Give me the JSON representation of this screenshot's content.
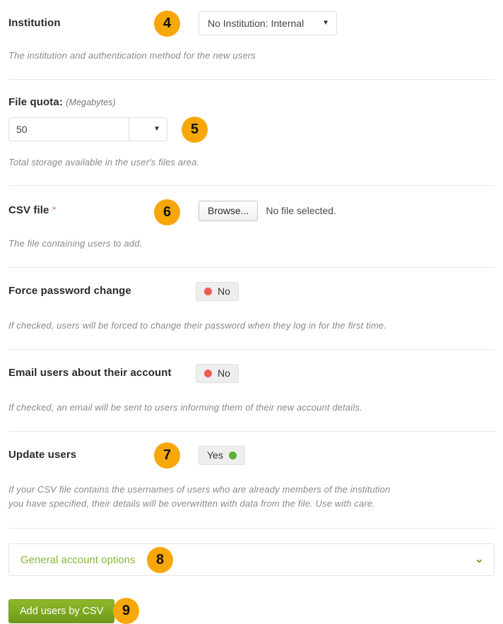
{
  "form": {
    "rows": [
      {
        "key": "institution",
        "label": "Institution",
        "badge": "4",
        "control_type": "select",
        "value": "No Institution: Internal",
        "caret_icon": "▼",
        "help": "The institution and authentication method for the new users"
      },
      {
        "key": "file_quota",
        "label": "File quota:",
        "units": "(Megabytes)",
        "badge": "5",
        "control_type": "number-stepper",
        "value": "50",
        "caret_icon": "▼",
        "help": "Total storage available in the user's files area."
      },
      {
        "key": "csv_file",
        "label": "CSV file",
        "required_marker": "*",
        "badge": "6",
        "control_type": "file",
        "browse_label": "Browse...",
        "file_status": "No file selected.",
        "help": "The file containing users to add."
      },
      {
        "key": "force_password_change",
        "label": "Force password change",
        "control_type": "switch",
        "value": "No",
        "state": "off",
        "help": "If checked, users will be forced to change their password when they log in for the first time."
      },
      {
        "key": "email_users",
        "label": "Email users about their account",
        "control_type": "switch",
        "value": "No",
        "state": "off",
        "help": "If checked, an email will be sent to users informing them of their new account details."
      },
      {
        "key": "update_users",
        "label": "Update users",
        "badge": "7",
        "control_type": "switch",
        "value": "Yes",
        "state": "on",
        "help": "If your CSV file contains the usernames of users who are already members of the institution you have specified, their details will be overwritten with data from the file. Use with care."
      }
    ]
  },
  "collapsible": {
    "title": "General account options",
    "badge": "8",
    "chevron_icon": "⌄"
  },
  "submit": {
    "label": "Add users by CSV",
    "badge": "9"
  },
  "colors": {
    "badge_bg": "#f7a708",
    "accent_green": "#8bb63c",
    "button_green": "#6f9a18",
    "status_off": "#ef5a52",
    "status_on": "#5bb030",
    "required_star": "#f27871",
    "divider": "#e8e8e8"
  }
}
